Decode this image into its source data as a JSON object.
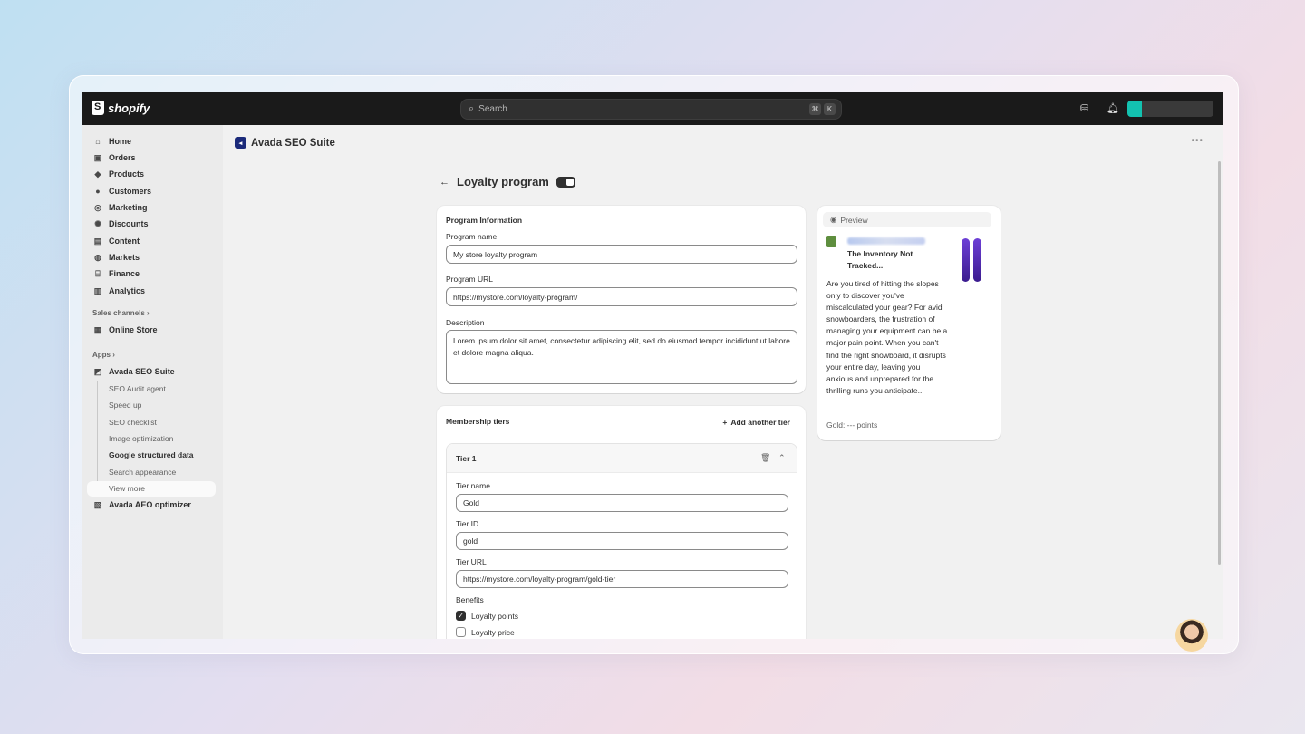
{
  "topbar": {
    "brand": "shopify",
    "search_placeholder": "Search",
    "shortcut_keys": [
      "⌘",
      "K"
    ]
  },
  "sidebar": {
    "items": [
      {
        "label": "Home",
        "icon": "home-icon"
      },
      {
        "label": "Orders",
        "icon": "inbox-icon"
      },
      {
        "label": "Products",
        "icon": "tag-icon"
      },
      {
        "label": "Customers",
        "icon": "person-icon"
      },
      {
        "label": "Marketing",
        "icon": "target-icon"
      },
      {
        "label": "Discounts",
        "icon": "discount-icon"
      },
      {
        "label": "Content",
        "icon": "content-icon"
      },
      {
        "label": "Markets",
        "icon": "globe-icon"
      },
      {
        "label": "Finance",
        "icon": "bank-icon"
      },
      {
        "label": "Analytics",
        "icon": "chart-icon"
      }
    ],
    "sales_channels_title": "Sales channels",
    "online_store": "Online Store",
    "apps_title": "Apps",
    "app_name": "Avada SEO Suite",
    "app_subitems": [
      "SEO Audit agent",
      "Speed up",
      "SEO checklist",
      "Image optimization",
      "Google structured data",
      "Search appearance",
      "View more"
    ],
    "aeo_app": "Avada AEO optimizer"
  },
  "header": {
    "app_title": "Avada SEO Suite"
  },
  "page": {
    "title": "Loyalty program",
    "enabled": true
  },
  "program_info": {
    "title": "Program Information",
    "name_label": "Program name",
    "name_value": "My store loyalty program",
    "url_label": "Program URL",
    "url_value": "https://mystore.com/loyalty-program/",
    "desc_label": "Description",
    "desc_value": "Lorem ipsum dolor sit amet, consectetur adipiscing elit, sed do eiusmod tempor incididunt ut labore et dolore magna aliqua."
  },
  "tiers": {
    "title": "Membership tiers",
    "add_label": "Add another tier",
    "tier1": {
      "header": "Tier 1",
      "name_label": "Tier name",
      "name_value": "Gold",
      "id_label": "Tier ID",
      "id_value": "gold",
      "url_label": "Tier URL",
      "url_value": "https://mystore.com/loyalty-program/gold-tier",
      "benefits_label": "Benefits",
      "benefits": [
        {
          "label": "Loyalty points",
          "checked": true
        },
        {
          "label": "Loyalty price",
          "checked": false
        }
      ]
    }
  },
  "preview": {
    "title": "Preview",
    "product_title": "The Inventory Not Tracked...",
    "description": "Are you tired of hitting the slopes only to discover you've miscalculated your gear? For avid snowboarders, the frustration of managing your equipment can be a major pain point. When you can't find the right snowboard, it disrupts your entire day, leaving you anxious and unprepared for the thrilling runs you anticipate...",
    "points": "Gold: --- points"
  },
  "colors": {
    "topbar": "#1a1a1a",
    "sidebar": "#ebebeb",
    "canvas": "#f1f1f1",
    "card": "#ffffff",
    "app_logo": "#1b2a7a",
    "snowboard": "#6d3fd6"
  }
}
